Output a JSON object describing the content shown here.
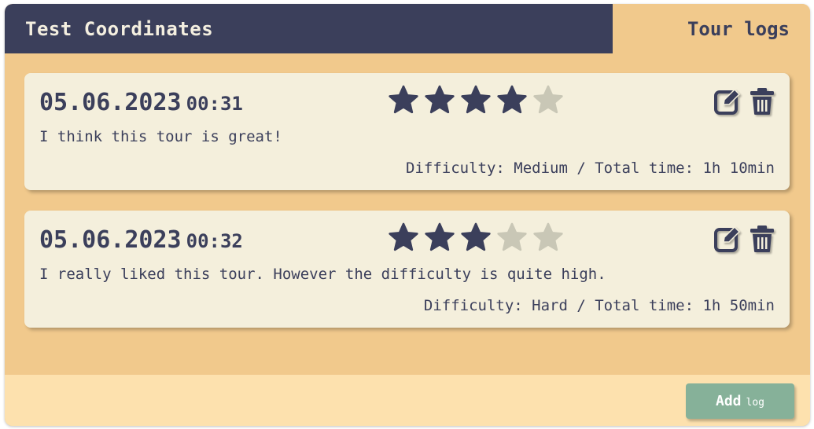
{
  "header": {
    "title": "Test Coordinates",
    "active_tab": "Tour logs"
  },
  "colors": {
    "primary": "#3b3f5b",
    "panel": "#f1c98c",
    "card": "#f4efdc",
    "footer": "#fde1ae",
    "button": "#86b199",
    "star_filled": "#3b3f5b",
    "star_empty": "#c9c7b6"
  },
  "logs": [
    {
      "date": "05.06.2023",
      "time": "00:31",
      "rating": 4,
      "rating_max": 5,
      "comment": "I think this tour is great!",
      "meta": "Difficulty: Medium / Total time: 1h 10min"
    },
    {
      "date": "05.06.2023",
      "time": "00:32",
      "rating": 3,
      "rating_max": 5,
      "comment": "I really liked this tour. However the difficulty is quite high.",
      "meta": "Difficulty: Hard / Total time: 1h 50min"
    }
  ],
  "icons": {
    "edit": "edit-icon",
    "delete": "trash-icon",
    "star": "star-icon"
  },
  "footer": {
    "add_label": "Add",
    "add_suffix": "log"
  }
}
